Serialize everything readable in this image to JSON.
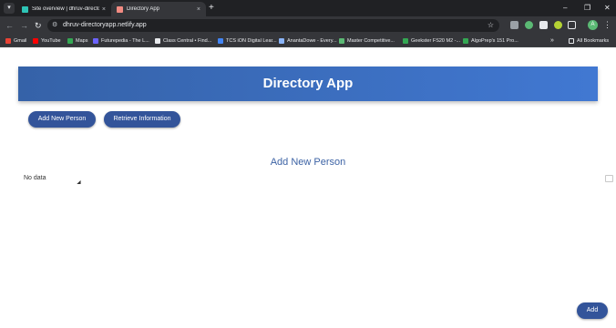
{
  "browser": {
    "tabs": [
      {
        "title": "Site overview | dhruv-directory",
        "close": "×",
        "favicon_color": "#2ec4b6"
      },
      {
        "title": "Directory App",
        "close": "×",
        "favicon_color": "#f28b82"
      }
    ],
    "tab_menu_glyph": "▾",
    "new_tab_glyph": "+",
    "window_controls": {
      "minimize": "–",
      "restore": "❐",
      "close": "✕"
    },
    "nav": {
      "back": "←",
      "forward": "→",
      "reload": "↻"
    },
    "omnibox": {
      "tune_glyph": "⚙",
      "url": "dhruv-directoryapp.netlify.app",
      "star": "☆"
    },
    "profile_initial": "A",
    "menu_glyph": "⋮",
    "bookmarks": [
      {
        "label": "Gmail",
        "color": "#ea4335"
      },
      {
        "label": "YouTube",
        "color": "#ff0000"
      },
      {
        "label": "Maps",
        "color": "#34a853"
      },
      {
        "label": "Futurepedia - The L...",
        "color": "#6c63ff"
      },
      {
        "label": "Class Central • Find...",
        "color": "#e8eaed"
      },
      {
        "label": "TCS iON Digital Lear...",
        "color": "#4285f4"
      },
      {
        "label": "AnantaDowe - Every...",
        "color": "#8ab4f8"
      },
      {
        "label": "Master Competitive...",
        "color": "#5bb974"
      },
      {
        "label": "Geekster FS20 M2 -...",
        "color": "#34a853"
      },
      {
        "label": "AlgoPrep's 151 Pro...",
        "color": "#34a853"
      }
    ],
    "bookmarks_more": "»",
    "all_bookmarks": "All Bookmarks"
  },
  "app": {
    "title": "Directory App",
    "buttons": {
      "add_new_person": "Add New Person",
      "retrieve_information": "Retrieve Information",
      "add": "Add"
    },
    "section_title": "Add New Person",
    "empty_message": "No data"
  }
}
